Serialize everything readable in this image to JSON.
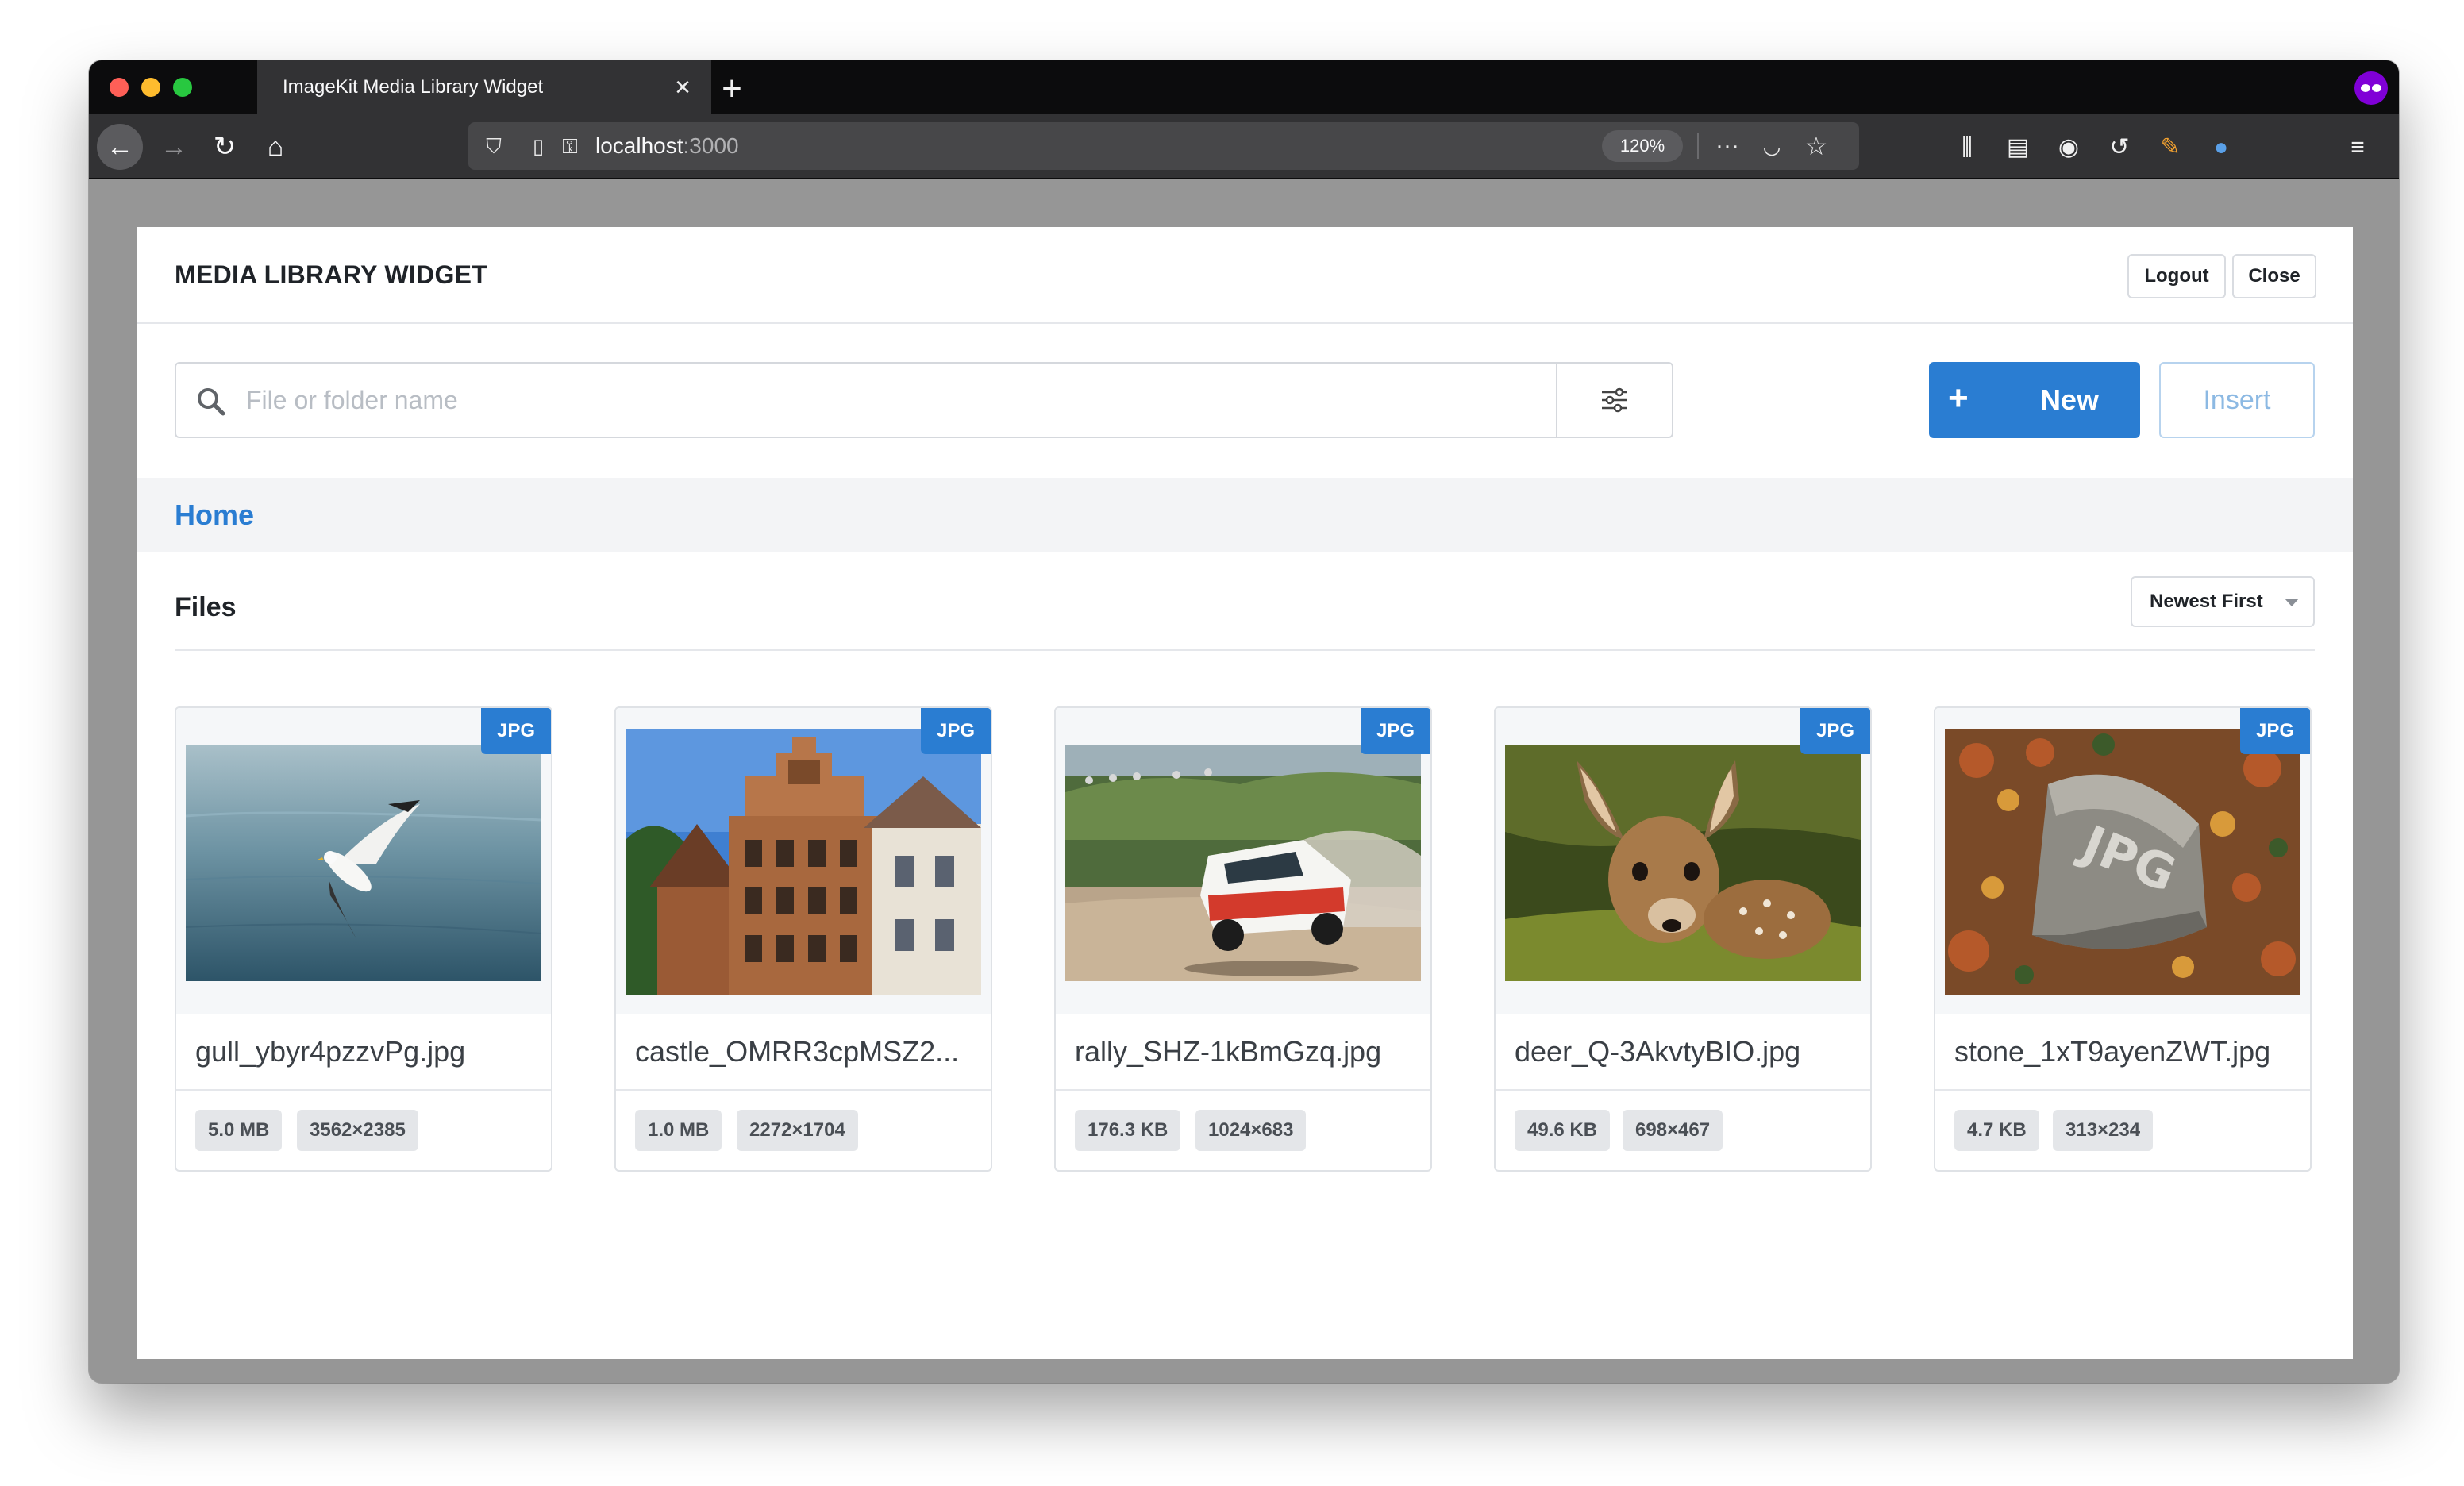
{
  "browser": {
    "tab_title": "ImageKit Media Library Widget",
    "url_host": "localhost",
    "url_port": ":3000",
    "zoom": "120%"
  },
  "app": {
    "title": "MEDIA LIBRARY WIDGET",
    "logout_label": "Logout",
    "close_label": "Close",
    "search_placeholder": "File or folder name",
    "new_label": "New",
    "insert_label": "Insert",
    "breadcrumb": "Home",
    "files_heading": "Files",
    "sort": "Newest First",
    "accent_color": "#2a7dd2"
  },
  "files": [
    {
      "name": "gull_ybyr4pzzvPg.jpg",
      "type": "JPG",
      "size": "5.0 MB",
      "dims": "3562×2385"
    },
    {
      "name": "castle_OMRR3cpMSZ2...",
      "type": "JPG",
      "size": "1.0 MB",
      "dims": "2272×1704"
    },
    {
      "name": "rally_SHZ-1kBmGzq.jpg",
      "type": "JPG",
      "size": "176.3 KB",
      "dims": "1024×683"
    },
    {
      "name": "deer_Q-3AkvtyBIO.jpg",
      "type": "JPG",
      "size": "49.6 KB",
      "dims": "698×467"
    },
    {
      "name": "stone_1xT9ayenZWT.jpg",
      "type": "JPG",
      "size": "4.7 KB",
      "dims": "313×234"
    }
  ]
}
